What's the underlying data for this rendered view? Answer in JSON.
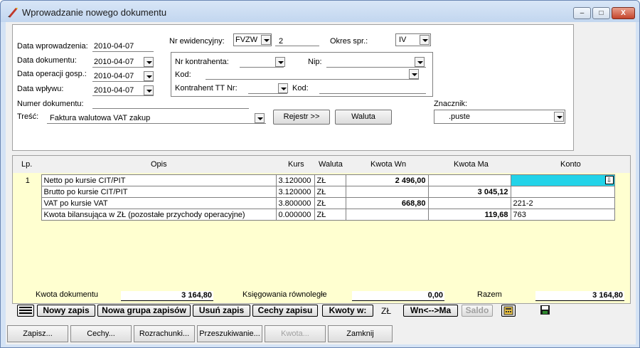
{
  "window": {
    "title": "Wprowadzanie nowego dokumentu",
    "min_label": "–",
    "max_label": "□",
    "close_label": "X"
  },
  "header": {
    "data_wprowadzenia_label": "Data wprowadzenia:",
    "data_wprowadzenia": "2010-04-07",
    "data_dokumentu_label": "Data dokumentu:",
    "data_dokumentu": "2010-04-07",
    "data_operacji_label": "Data operacji gosp.:",
    "data_operacji": "2010-04-07",
    "data_wplywu_label": "Data wpływu:",
    "data_wplywu": "2010-04-07",
    "numer_dokumentu_label": "Numer dokumentu:",
    "tresc_label": "Treść:",
    "tresc": "Faktura walutowa VAT zakup",
    "nr_ewid_label": "Nr ewidencyjny:",
    "nr_ewid_rejestr": "FVZW",
    "nr_ewid_numer": "2",
    "okres_label": "Okres spr.:",
    "okres": "IV",
    "nr_kontrahenta_label": "Nr kontrahenta:",
    "nip_label": "Nip:",
    "kod_label": "Kod:",
    "kontrahent_tt_label": "Kontrahent TT Nr:",
    "kod2_label": "Kod:",
    "rejestr_button": "Rejestr >>",
    "waluta_button": "Waluta",
    "znacznik_label": "Znacznik:",
    "znacznik": ".puste"
  },
  "grid": {
    "columns": [
      "Lp.",
      "Opis",
      "Kurs",
      "Waluta",
      "Kwota Wn",
      "Kwota Ma",
      "Konto"
    ],
    "rows": [
      {
        "lp": "1",
        "opis": "Netto po kursie CIT/PIT",
        "kurs": "3.120000",
        "waluta": "ZŁ",
        "wn": "2 496,00",
        "ma": "",
        "konto": ""
      },
      {
        "lp": "",
        "opis": "Brutto po kursie CIT/PIT",
        "kurs": "3.120000",
        "waluta": "ZŁ",
        "wn": "",
        "ma": "3 045,12",
        "konto": ""
      },
      {
        "lp": "",
        "opis": "VAT po kursie VAT",
        "kurs": "3.800000",
        "waluta": "ZŁ",
        "wn": "668,80",
        "ma": "",
        "konto": "221-2"
      },
      {
        "lp": "",
        "opis": "Kwota bilansująca w ZŁ (pozostałe przychody operacyjne)",
        "kurs": "0.000000",
        "waluta": "ZŁ",
        "wn": "",
        "ma": "119,68",
        "konto": "763"
      }
    ]
  },
  "totals": {
    "kwota_dokumentu_label": "Kwota dokumentu",
    "kwota_dokumentu": "3 164,80",
    "ksiegowania_label": "Księgowania równoległe",
    "ksiegowania": "0,00",
    "razem_label": "Razem",
    "razem": "3 164,80"
  },
  "toolbar": {
    "nowy_zapis": "Nowy zapis",
    "nowa_grupa": "Nowa grupa zapisów",
    "usun_zapis": "Usuń zapis",
    "cechy_zapisu": "Cechy zapisu",
    "kwoty_w": "Kwoty w:",
    "waluta": "ZŁ",
    "wn_ma": "Wn<-->Ma",
    "saldo": "Saldo"
  },
  "bottom": {
    "zapisz": "Zapisz...",
    "cechy": "Cechy...",
    "rozrachunki": "Rozrachunki...",
    "przeszukiwanie": "Przeszukiwanie...",
    "kwota": "Kwota...",
    "zamknij": "Zamknij"
  },
  "colors": {
    "selected_cell": "#22d3e8",
    "grid_background": "#ffffd0"
  }
}
